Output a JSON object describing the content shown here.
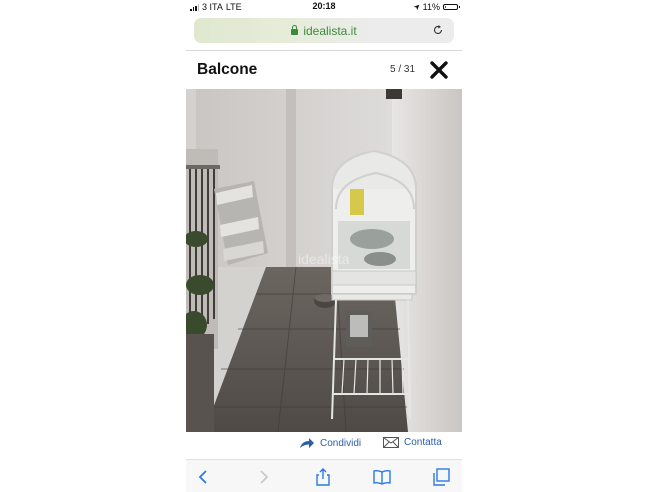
{
  "status_bar": {
    "carrier": "3 ITA",
    "network": "LTE",
    "time": "20:18",
    "battery": "11%",
    "battery_level": 0.11
  },
  "browser": {
    "url": "idealista.it"
  },
  "gallery": {
    "title": "Balcone",
    "counter": "5 / 31"
  },
  "photo": {
    "watermark": "idealista"
  },
  "actions": {
    "share_label": "Condividi",
    "contact_label": "Contatta"
  },
  "colors": {
    "link": "#2a5ea8",
    "secure_green": "#3c8a3c",
    "battery_low": "#e22222"
  },
  "icons": [
    "lock-icon",
    "reload-icon",
    "close-icon",
    "share-arrow-icon",
    "envelope-icon",
    "back-icon",
    "forward-icon",
    "share-icon",
    "bookmarks-icon",
    "tabs-icon"
  ]
}
